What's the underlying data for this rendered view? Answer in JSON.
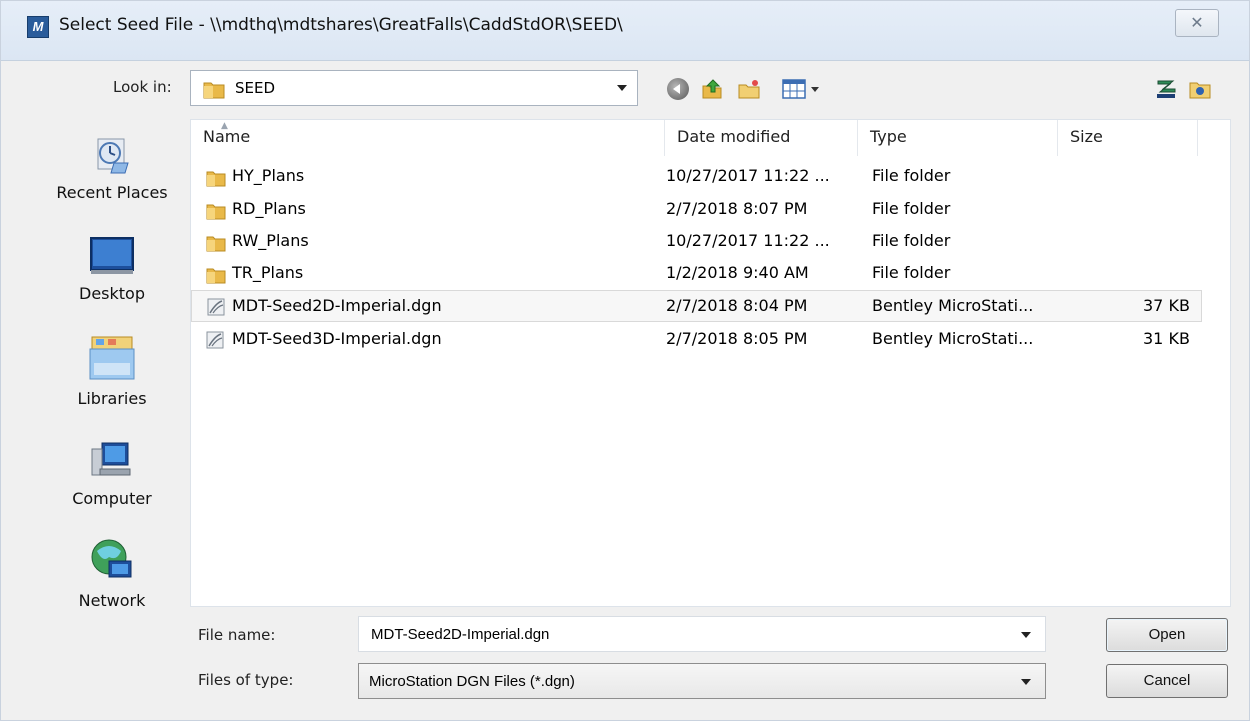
{
  "window": {
    "title": "Select Seed File - \\\\mdthq\\mdtshares\\GreatFalls\\CaddStdOR\\SEED\\",
    "close_glyph": "✕"
  },
  "toolbar": {
    "lookin_label": "Look in:",
    "lookin_value": "SEED"
  },
  "places": [
    {
      "label": "Recent Places",
      "icon": "recent-places-icon"
    },
    {
      "label": "Desktop",
      "icon": "desktop-icon"
    },
    {
      "label": "Libraries",
      "icon": "libraries-icon"
    },
    {
      "label": "Computer",
      "icon": "computer-icon"
    },
    {
      "label": "Network",
      "icon": "network-icon"
    }
  ],
  "columns": [
    "Name",
    "Date modified",
    "Type",
    "Size"
  ],
  "files": [
    {
      "name": "HY_Plans",
      "date": "10/27/2017 11:22 ...",
      "type": "File folder",
      "size": "",
      "kind": "folder"
    },
    {
      "name": "RD_Plans",
      "date": "2/7/2018 8:07 PM",
      "type": "File folder",
      "size": "",
      "kind": "folder"
    },
    {
      "name": "RW_Plans",
      "date": "10/27/2017 11:22 ...",
      "type": "File folder",
      "size": "",
      "kind": "folder"
    },
    {
      "name": "TR_Plans",
      "date": "1/2/2018 9:40 AM",
      "type": "File folder",
      "size": "",
      "kind": "folder"
    },
    {
      "name": "MDT-Seed2D-Imperial.dgn",
      "date": "2/7/2018 8:04 PM",
      "type": "Bentley MicroStati...",
      "size": "37 KB",
      "kind": "dgn"
    },
    {
      "name": "MDT-Seed3D-Imperial.dgn",
      "date": "2/7/2018 8:05 PM",
      "type": "Bentley MicroStati...",
      "size": "31 KB",
      "kind": "dgn"
    }
  ],
  "footer": {
    "filename_label": "File name:",
    "filename_value": "MDT-Seed2D-Imperial.dgn",
    "filetype_label": "Files of type:",
    "filetype_value": "MicroStation DGN Files (*.dgn)",
    "open_label": "Open",
    "cancel_label": "Cancel"
  },
  "colors": {
    "titlebar": "#dbe6f3",
    "folder": "#e9b949",
    "selection": "#f7f7f7"
  }
}
